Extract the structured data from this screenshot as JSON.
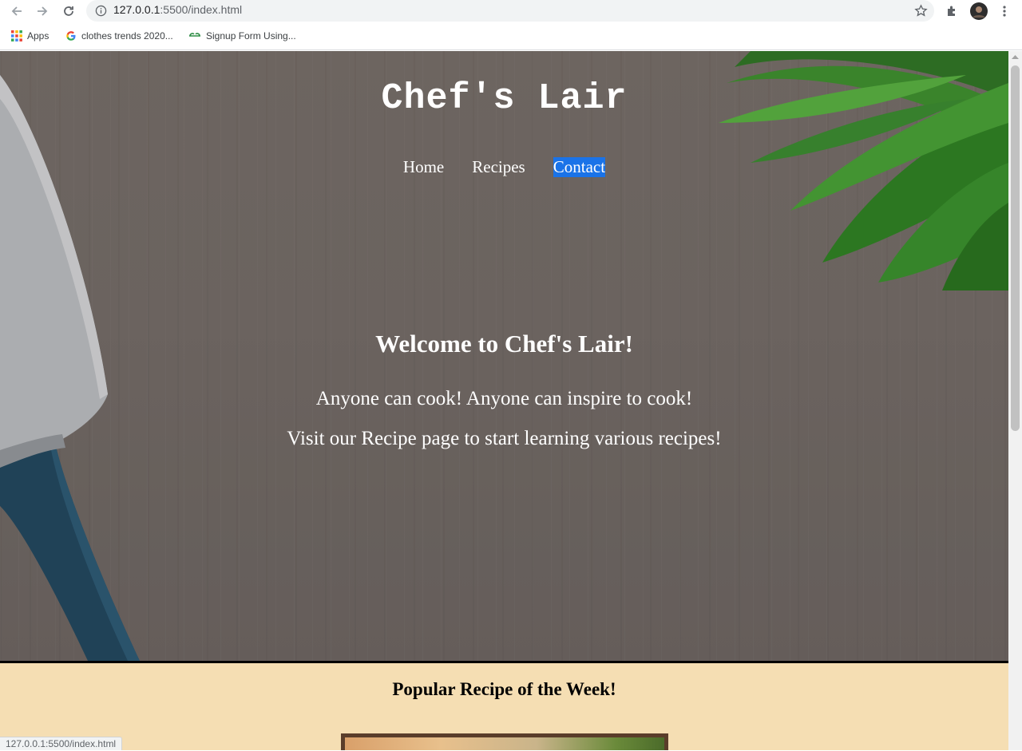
{
  "browser": {
    "url_host": "127.0.0.1",
    "url_path": ":5500/index.html",
    "bookmarks": [
      {
        "label": "Apps"
      },
      {
        "label": "clothes trends 2020..."
      },
      {
        "label": "Signup Form Using..."
      }
    ],
    "status_url": "127.0.0.1:5500/index.html"
  },
  "site": {
    "title": "Chef's Lair",
    "nav": [
      "Home",
      "Recipes",
      "Contact"
    ],
    "active_nav": "Contact",
    "accent": "#1a73e8"
  },
  "hero": {
    "heading": "Welcome to Chef's Lair!",
    "line1": "Anyone can cook! Anyone can inspire to cook!",
    "line2": "Visit our Recipe page to start learning various recipes!"
  },
  "popular": {
    "heading": "Popular Recipe of the Week!",
    "background": "#f5deb3"
  }
}
